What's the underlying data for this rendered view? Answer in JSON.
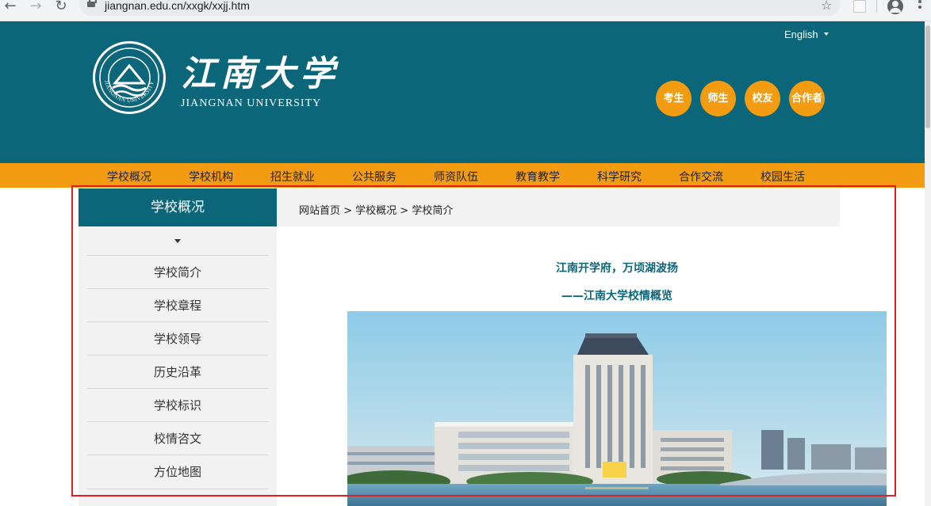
{
  "browser": {
    "url": "jiangnan.edu.cn/xxgk/xxjj.htm",
    "back_icon": "back-arrow-icon",
    "forward_icon": "forward-arrow-icon",
    "reload_icon": "reload-icon",
    "bookmark_icon": "star-icon"
  },
  "header": {
    "logo_cn": "江南大学",
    "logo_en": "JIANGNAN UNIVERSITY",
    "seal_text": "JIANGNAN UNIVERSITY",
    "language": "English",
    "quick_links": [
      "考生",
      "师生",
      "校友",
      "合作者"
    ]
  },
  "nav": {
    "items": [
      "学校概况",
      "学校机构",
      "招生就业",
      "公共服务",
      "师资队伍",
      "教育教学",
      "科学研究",
      "合作交流",
      "校园生活"
    ]
  },
  "sidebar": {
    "title": "学校概况",
    "items": [
      "学校简介",
      "学校章程",
      "学校领导",
      "历史沿革",
      "学校标识",
      "校情咨文",
      "方位地图"
    ]
  },
  "breadcrumb": {
    "text": "网站首页 > 学校概况 > 学校简介"
  },
  "article": {
    "title": "江南开学府，万顷湖波扬",
    "subtitle": "——江南大学校情概览"
  },
  "colors": {
    "brand_teal": "#0c6679",
    "accent_orange": "#f39c12",
    "highlight_red": "#e02020"
  }
}
